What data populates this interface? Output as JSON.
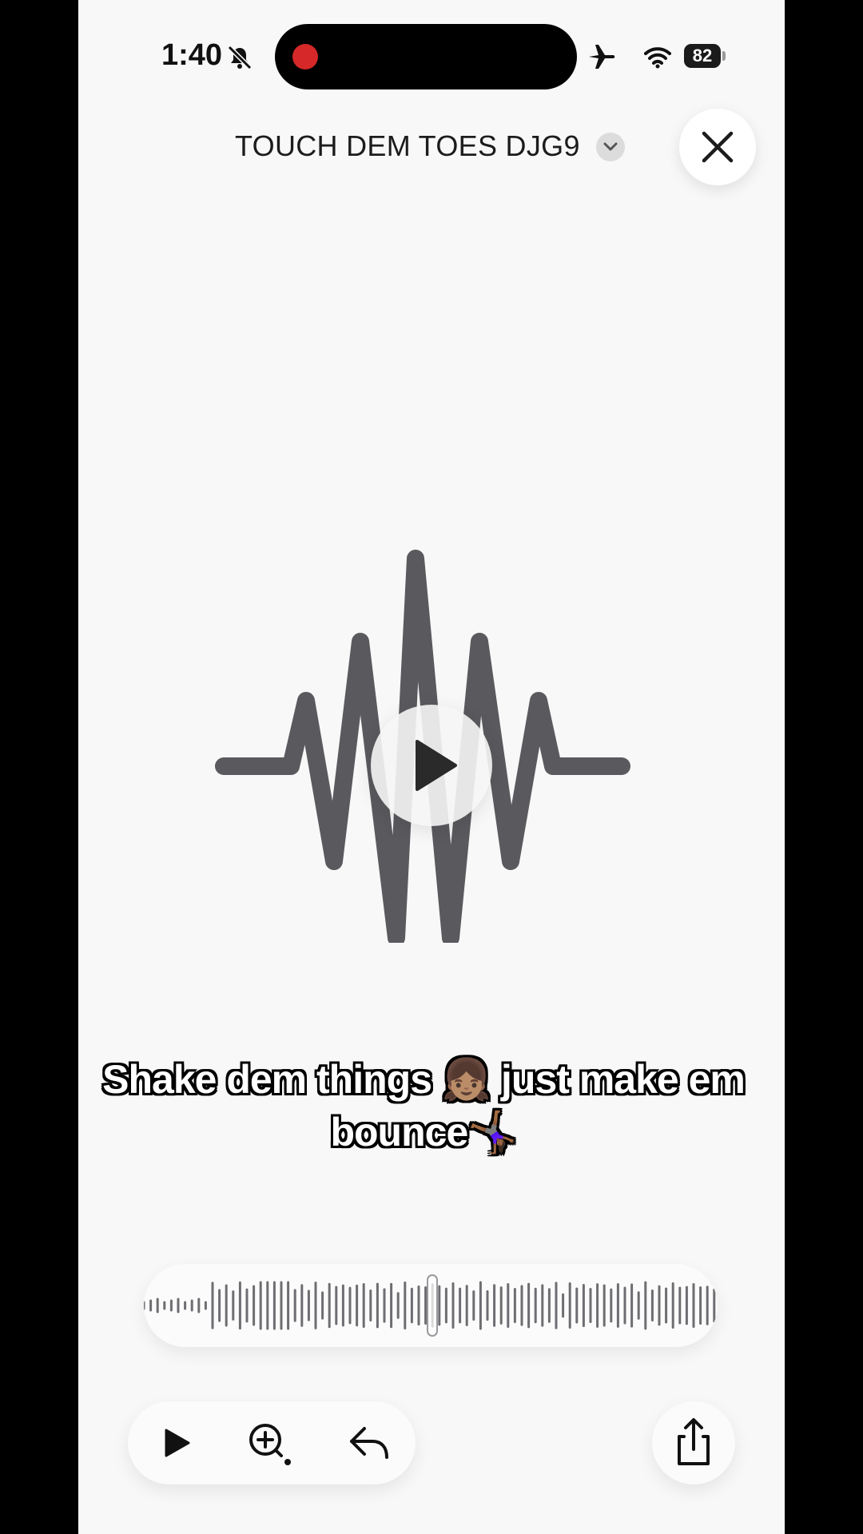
{
  "status_bar": {
    "time": "1:40",
    "battery": "82",
    "icons": [
      "bell-slash-icon",
      "airplane-icon",
      "wifi-icon",
      "battery-icon"
    ],
    "recording_indicator_color": "#d62828"
  },
  "header": {
    "title": "TOUCH DEM TOES DJG9",
    "dropdown_icon": "chevron-down-icon",
    "close_icon": "close-icon"
  },
  "player": {
    "center_icon": "audio-waveform-icon",
    "play_icon": "play-icon",
    "wave_color": "#5a5a5e"
  },
  "caption": {
    "line1": "Shake dem things 👧🏽 just make em",
    "line2": "bounce🤸🏾‍♀️"
  },
  "scrubber": {
    "icon": "waveform-scrubber",
    "bar_color": "#6e6e72"
  },
  "controls": {
    "play": "play-icon",
    "zoom": "zoom-in-icon",
    "reply": "reply-icon",
    "share": "share-icon"
  }
}
